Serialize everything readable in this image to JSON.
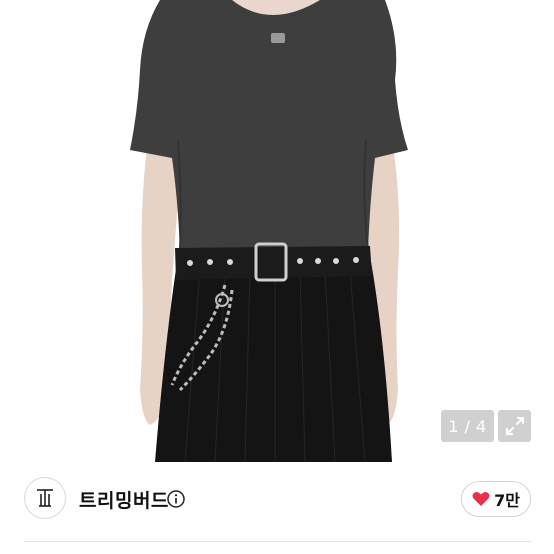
{
  "gallery": {
    "counter": "1 / 4",
    "expand_icon": "expand-icon"
  },
  "seller": {
    "logo_icon": "brand-logo",
    "name": "트리밍버드",
    "info_icon": "info-icon"
  },
  "like": {
    "icon": "heart-icon",
    "count": "7만",
    "color": "#e8304a"
  }
}
